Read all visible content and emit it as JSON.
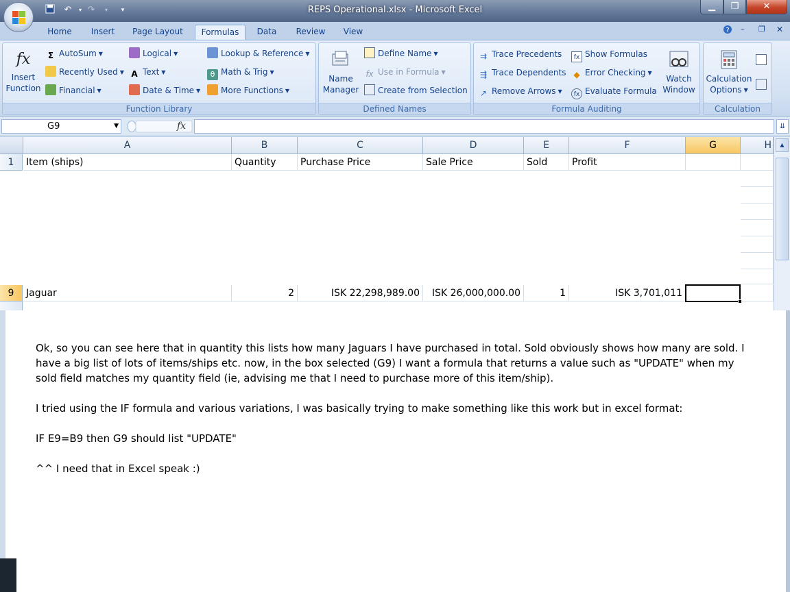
{
  "window": {
    "title": "REPS Operational.xlsx - Microsoft Excel"
  },
  "tabs": [
    {
      "label": "Home"
    },
    {
      "label": "Insert"
    },
    {
      "label": "Page Layout"
    },
    {
      "label": "Formulas",
      "active": true
    },
    {
      "label": "Data"
    },
    {
      "label": "Review"
    },
    {
      "label": "View"
    }
  ],
  "ribbon": {
    "insert_function": {
      "line1": "Insert",
      "line2": "Function"
    },
    "function_library": {
      "label": "Function Library",
      "autosum": "AutoSum",
      "recently_used": "Recently Used",
      "financial": "Financial",
      "logical": "Logical",
      "text": "Text",
      "date_time": "Date & Time",
      "lookup": "Lookup & Reference",
      "math": "Math & Trig",
      "more": "More Functions"
    },
    "defined_names": {
      "label": "Defined Names",
      "name_manager_1": "Name",
      "name_manager_2": "Manager",
      "define_name": "Define Name",
      "use_in_formula": "Use in Formula",
      "create_from_selection": "Create from Selection"
    },
    "formula_auditing": {
      "label": "Formula Auditing",
      "trace_precedents": "Trace Precedents",
      "trace_dependents": "Trace Dependents",
      "remove_arrows": "Remove Arrows",
      "show_formulas": "Show Formulas",
      "error_checking": "Error Checking",
      "evaluate_formula": "Evaluate Formula",
      "watch_1": "Watch",
      "watch_2": "Window"
    },
    "calculation": {
      "label": "Calculation",
      "options_1": "Calculation",
      "options_2": "Options"
    }
  },
  "formula_bar": {
    "name_box": "G9",
    "fx": "fx",
    "formula": ""
  },
  "grid": {
    "columns": [
      "A",
      "B",
      "C",
      "D",
      "E",
      "F",
      "G",
      "H"
    ],
    "selected_column": "G",
    "header_row": {
      "row": "1",
      "cells": [
        "Item (ships)",
        "Quantity",
        "Purchase Price",
        "Sale Price",
        "Sold",
        "Profit",
        "",
        ""
      ]
    },
    "data_row": {
      "row": "9",
      "cells": [
        "Jaguar",
        "2",
        "ISK 22,298,989.00",
        "ISK 26,000,000.00",
        "1",
        "ISK 3,701,011",
        "",
        ""
      ]
    }
  },
  "note": {
    "p1a": "Ok, so you can see here that in quantity this lists how many Jaguars I have purchased in total. Sold obviously shows how many are sold. I",
    "p1b": "have a big list of lots of items/ships etc. now, in the box selected (G9) I want a formula that returns a value such as \"UPDATE\" when my",
    "p1c": "sold field matches my quantity field (ie, advising me that I need to purchase more of this item/ship).",
    "p2": "I tried using the IF formula and various variations, I was basically trying to make something like this work but in excel format:",
    "p3": "IF E9=B9 then G9 should list \"UPDATE\"",
    "p4": "^^ I need that in Excel speak :)"
  }
}
